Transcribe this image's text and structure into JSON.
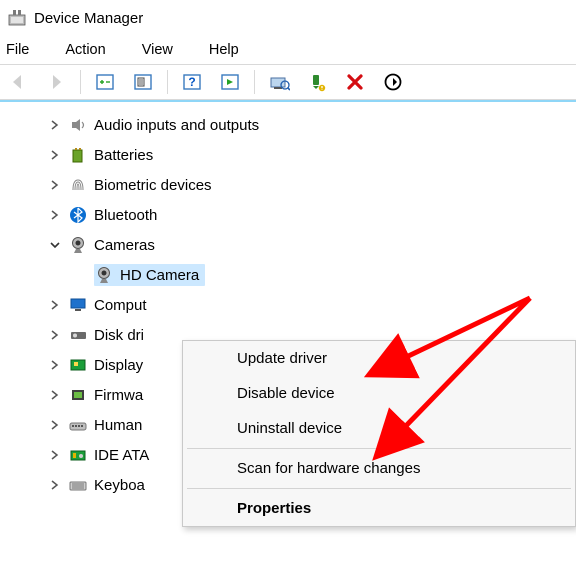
{
  "title": "Device Manager",
  "menubar": {
    "file": "File",
    "action": "Action",
    "view": "View",
    "help": "Help"
  },
  "tree": {
    "items": [
      {
        "label": "Audio inputs and outputs"
      },
      {
        "label": "Batteries"
      },
      {
        "label": "Biometric devices"
      },
      {
        "label": "Bluetooth"
      },
      {
        "label": "Cameras",
        "expanded": true,
        "children": [
          {
            "label": "HD Camera",
            "selected": true
          }
        ]
      },
      {
        "label": "Computers"
      },
      {
        "label": "Disk drives"
      },
      {
        "label": "Display adapters"
      },
      {
        "label": "Firmware"
      },
      {
        "label": "Human Interface Devices"
      },
      {
        "label": "IDE ATA/ATAPI controllers"
      },
      {
        "label": "Keyboards"
      }
    ],
    "truncated": {
      "computers": "Comput",
      "disk": "Disk dri",
      "display": "Display",
      "firmware": "Firmwa",
      "human": "Human",
      "ide": "IDE ATA",
      "keyboards": "Keyboa"
    }
  },
  "contextmenu": {
    "update": "Update driver",
    "disable": "Disable device",
    "uninstall": "Uninstall device",
    "scan": "Scan for hardware changes",
    "properties": "Properties"
  }
}
